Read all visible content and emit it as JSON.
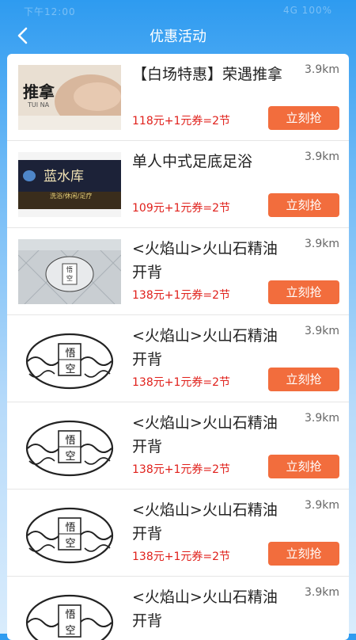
{
  "status_bar": {
    "left_text": "下午12:00",
    "right_text": "4G 100%"
  },
  "header": {
    "title": "优惠活动"
  },
  "colors": {
    "accent": "#2e9bf0",
    "button": "#f26d3d",
    "price": "#e0201b"
  },
  "items": [
    {
      "title": "【白场特惠】荣遇推拿",
      "distance": "3.9km",
      "price": "118元+1元券=2节",
      "button": "立刻抢",
      "image": "massage-photo",
      "image_caption": "推拿",
      "image_sub": "TUI NA"
    },
    {
      "title": "单人中式足底足浴",
      "distance": "3.9km",
      "price": "109元+1元券=2节",
      "button": "立刻抢",
      "image": "lanshuiku-logo",
      "image_caption": "蓝水库",
      "image_sub": "洗浴/休闲/足疗"
    },
    {
      "title": "<火焰山>火山石精油开背",
      "distance": "3.9km",
      "price": "138元+1元券=2节",
      "button": "立刻抢",
      "image": "wukong-floor-logo",
      "image_caption": "悟空"
    },
    {
      "title": "<火焰山>火山石精油开背",
      "distance": "3.9km",
      "price": "138元+1元券=2节",
      "button": "立刻抢",
      "image": "wukong-logo",
      "image_caption": "悟空"
    },
    {
      "title": "<火焰山>火山石精油开背",
      "distance": "3.9km",
      "price": "138元+1元券=2节",
      "button": "立刻抢",
      "image": "wukong-logo",
      "image_caption": "悟空"
    },
    {
      "title": "<火焰山>火山石精油开背",
      "distance": "3.9km",
      "price": "138元+1元券=2节",
      "button": "立刻抢",
      "image": "wukong-logo",
      "image_caption": "悟空"
    },
    {
      "title": "<火焰山>火山石精油开背",
      "distance": "3.9km",
      "price": "",
      "button": "",
      "image": "wukong-logo",
      "image_caption": "悟空"
    }
  ]
}
